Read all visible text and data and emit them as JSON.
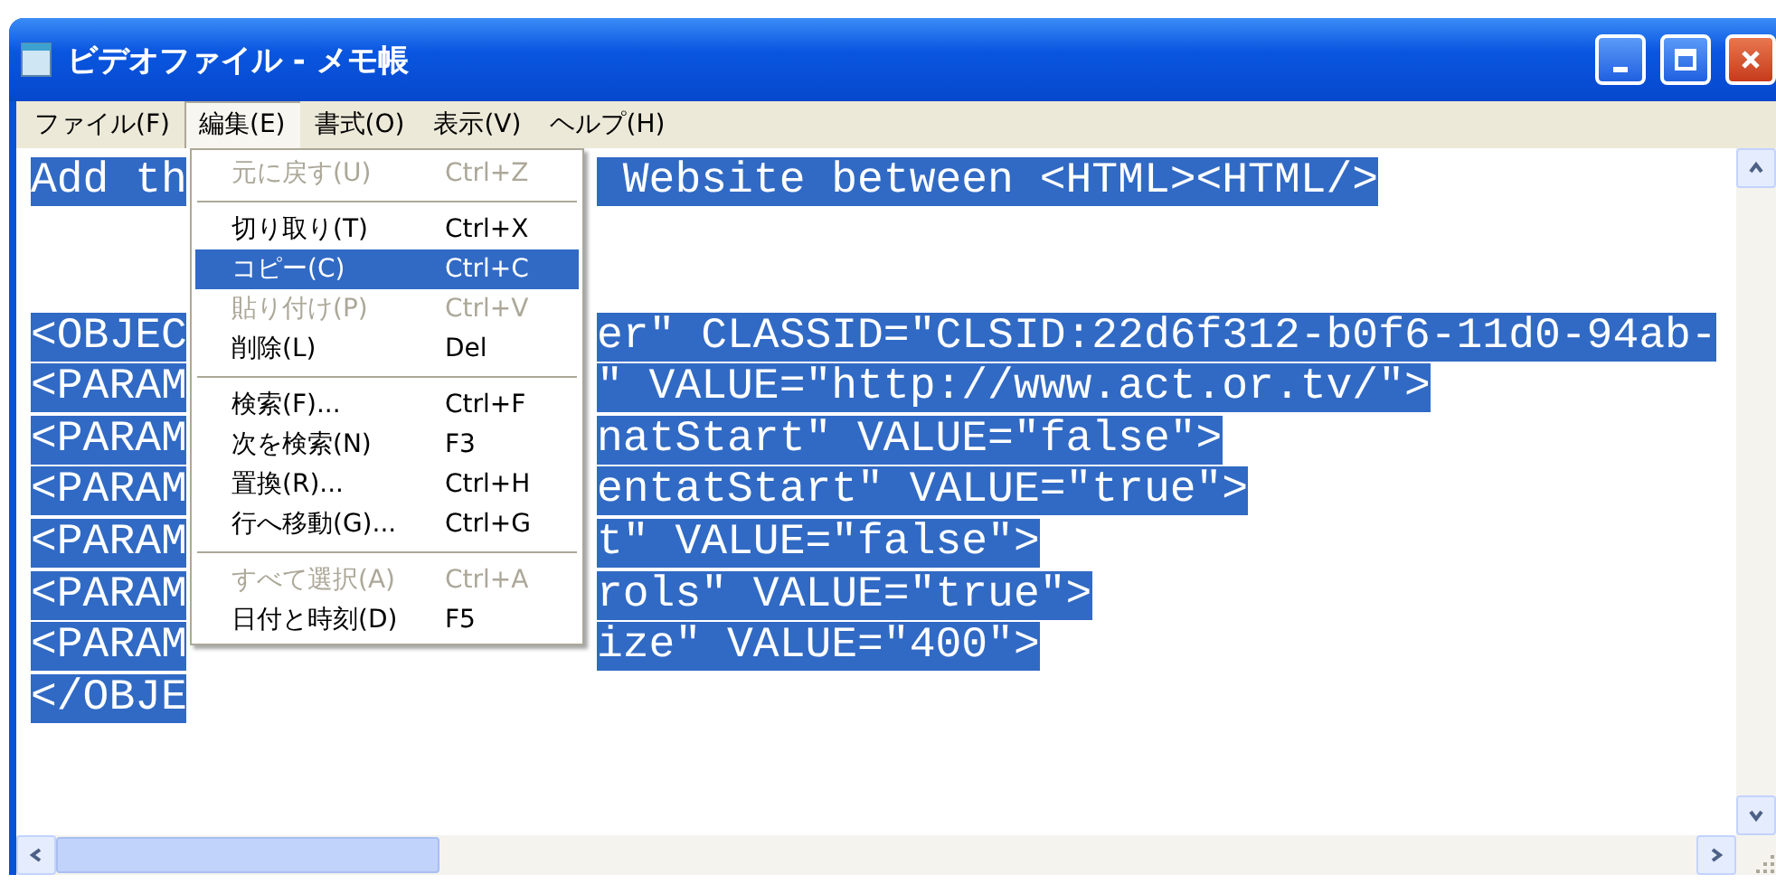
{
  "window": {
    "title": "ビデオファイル - メモ帳"
  },
  "menubar": [
    {
      "label": "ファイル(F)",
      "selected": false
    },
    {
      "label": "編集(E)",
      "selected": true
    },
    {
      "label": "書式(O)",
      "selected": false
    },
    {
      "label": "表示(V)",
      "selected": false
    },
    {
      "label": "ヘルプ(H)",
      "selected": false
    }
  ],
  "editor": {
    "lines": [
      {
        "kind": "text",
        "left": "Add th",
        "right": " Website between <HTML><HTML/>",
        "selected": true
      },
      {
        "kind": "blank"
      },
      {
        "kind": "blank"
      },
      {
        "kind": "text",
        "left": "<OBJEC",
        "right": "er\" CLASSID=\"CLSID:22d6f312-b0f6-11d0-94ab-",
        "selected": true
      },
      {
        "kind": "text",
        "left": "<PARAM",
        "right": "\" VALUE=\"http://www.act.or.tv/\">",
        "selected": true
      },
      {
        "kind": "text",
        "left": "<PARAM",
        "right": "natStart\" VALUE=\"false\">",
        "selected": true
      },
      {
        "kind": "text",
        "left": "<PARAM",
        "right": "entatStart\" VALUE=\"true\">",
        "selected": true
      },
      {
        "kind": "text",
        "left": "<PARAM",
        "right": "t\" VALUE=\"false\">",
        "selected": true
      },
      {
        "kind": "text",
        "left": "<PARAM",
        "right": "rols\" VALUE=\"true\">",
        "selected": true
      },
      {
        "kind": "text",
        "left": "<PARAM",
        "right": "ize\" VALUE=\"400\">",
        "selected": true
      },
      {
        "kind": "text",
        "left": "</OBJE",
        "selected": true
      }
    ]
  },
  "edit_menu": [
    {
      "kind": "item",
      "label": "元に戻す(U)",
      "shortcut": "Ctrl+Z",
      "disabled": true,
      "selected": false
    },
    {
      "kind": "separator"
    },
    {
      "kind": "item",
      "label": "切り取り(T)",
      "shortcut": "Ctrl+X",
      "disabled": false,
      "selected": false
    },
    {
      "kind": "item",
      "label": "コピー(C)",
      "shortcut": "Ctrl+C",
      "disabled": false,
      "selected": true
    },
    {
      "kind": "item",
      "label": "貼り付け(P)",
      "shortcut": "Ctrl+V",
      "disabled": true,
      "selected": false
    },
    {
      "kind": "item",
      "label": "削除(L)",
      "shortcut": "Del",
      "disabled": false,
      "selected": false
    },
    {
      "kind": "separator"
    },
    {
      "kind": "item",
      "label": "検索(F)...",
      "shortcut": "Ctrl+F",
      "disabled": false,
      "selected": false
    },
    {
      "kind": "item",
      "label": "次を検索(N)",
      "shortcut": "F3",
      "disabled": false,
      "selected": false
    },
    {
      "kind": "item",
      "label": "置換(R)...",
      "shortcut": "Ctrl+H",
      "disabled": false,
      "selected": false
    },
    {
      "kind": "item",
      "label": "行へ移動(G)...",
      "shortcut": "Ctrl+G",
      "disabled": false,
      "selected": false
    },
    {
      "kind": "separator"
    },
    {
      "kind": "item",
      "label": "すべて選択(A)",
      "shortcut": "Ctrl+A",
      "disabled": true,
      "selected": false
    },
    {
      "kind": "item",
      "label": "日付と時刻(D)",
      "shortcut": "F5",
      "disabled": false,
      "selected": false
    }
  ]
}
